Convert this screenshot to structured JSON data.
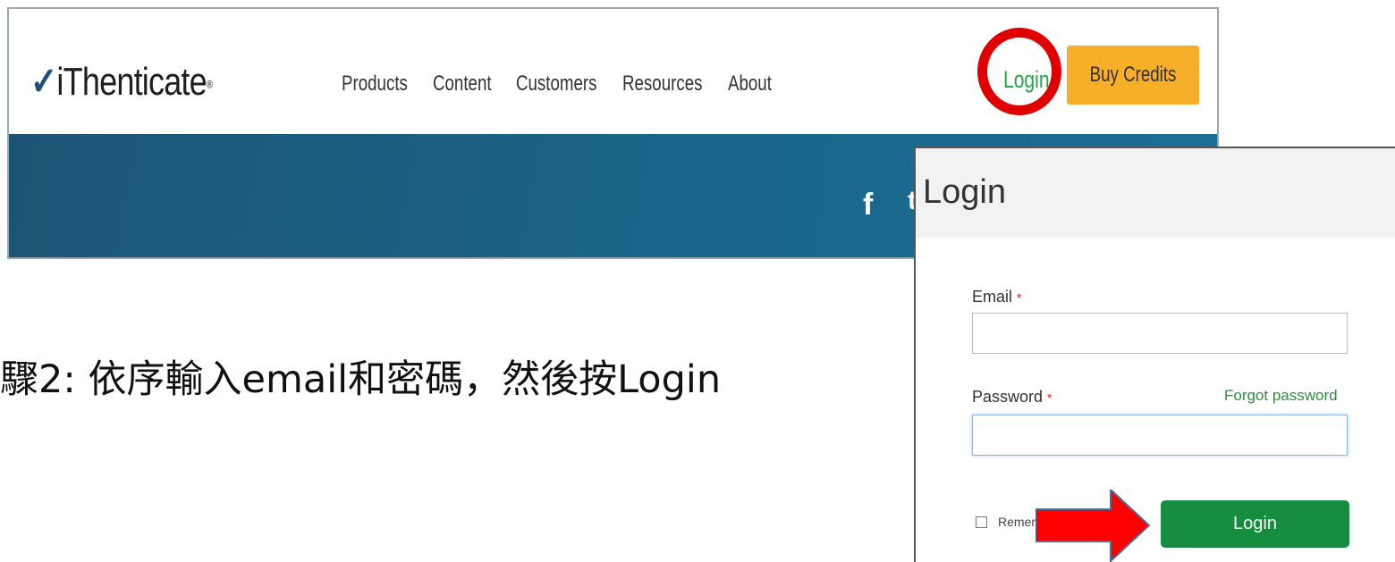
{
  "site": {
    "logo_text": "iThenticate",
    "logo_check": "✓",
    "logo_reg": "®",
    "nav": [
      "Products",
      "Content",
      "Customers",
      "Resources",
      "About"
    ],
    "login_label": "Login",
    "buy_credits_label": "Buy Credits",
    "social": {
      "facebook": "f",
      "twitter": "t"
    }
  },
  "caption": "驟2: 依序輸入email和密碼，然後按Login",
  "modal": {
    "title": "Login",
    "email_label": "Email",
    "password_label": "Password",
    "required_mark": "*",
    "forgot_label": "Forgot password",
    "remember_label": "Remem",
    "login_button": "Login",
    "email_value": "",
    "password_value": ""
  },
  "colors": {
    "highlight_circle": "#e00000",
    "arrow": "#ff0000",
    "login_green": "#158c3e",
    "buy_credits": "#f7ae28"
  }
}
